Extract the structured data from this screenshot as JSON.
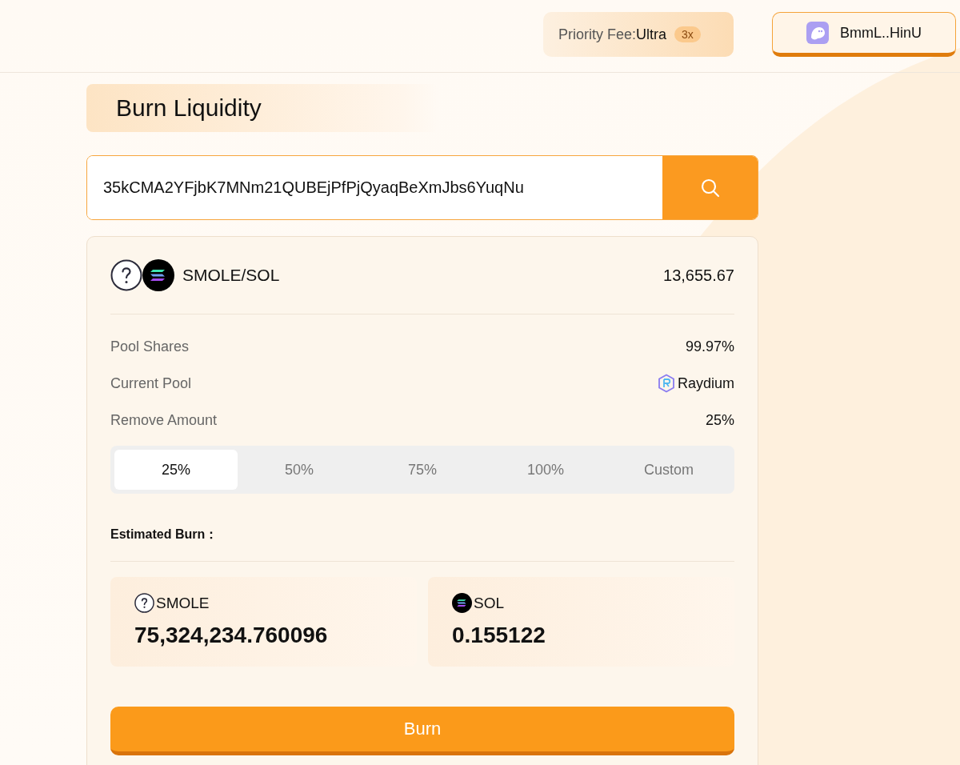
{
  "header": {
    "priority_fee": {
      "label": "Priority Fee:",
      "value": "Ultra",
      "badge": "3x"
    },
    "wallet": {
      "address": "BmmL..HinU"
    }
  },
  "title": "Burn Liquidity",
  "search": {
    "value": "35kCMA2YFjbK7MNm21QUBEjPfPjQyaqBeXmJbs6YuqNu"
  },
  "pair": {
    "tokens": [
      {
        "kind": "unknown"
      },
      {
        "kind": "sol"
      }
    ],
    "name": "SMOLE/SOL",
    "amount": "13,655.67"
  },
  "rows": [
    {
      "kind": "text",
      "label": "Pool Shares",
      "value": "99.97%"
    },
    {
      "kind": "pool",
      "label": "Current Pool",
      "value": "Raydium"
    },
    {
      "kind": "text",
      "label": "Remove Amount",
      "value": "25%"
    }
  ],
  "amount_options": [
    {
      "label": "25%",
      "selected": true
    },
    {
      "label": "50%",
      "selected": false
    },
    {
      "label": "75%",
      "selected": false
    },
    {
      "label": "100%",
      "selected": false
    },
    {
      "label": "Custom",
      "selected": false
    }
  ],
  "estimated_burn": {
    "label": "Estimated Burn：",
    "tokens": [
      {
        "kind": "unknown",
        "symbol": "SMOLE",
        "amount": "75,324,234.760096"
      },
      {
        "kind": "sol",
        "symbol": "SOL",
        "amount": "0.155122"
      }
    ]
  },
  "burn_button": "Burn"
}
